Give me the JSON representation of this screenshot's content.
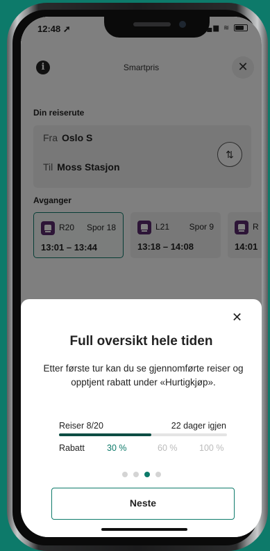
{
  "status_bar": {
    "time": "12:48",
    "location_glyph": "➚"
  },
  "header": {
    "title": "Smartpris",
    "info_glyph": "i",
    "close_glyph": "✕"
  },
  "route": {
    "section_label": "Din reiserute",
    "from_label": "Fra",
    "from_value": "Oslo S",
    "to_label": "Til",
    "to_value": "Moss Stasjon",
    "swap_glyph": "⇅"
  },
  "departures": {
    "section_label": "Avganger",
    "items": [
      {
        "line": "R20",
        "track": "Spor 18",
        "time": "13:01 – 13:44"
      },
      {
        "line": "L21",
        "track": "Spor 9",
        "time": "13:18 – 14:08"
      },
      {
        "line": "R",
        "track": "",
        "time": "14:01"
      }
    ]
  },
  "modal": {
    "close_glyph": "✕",
    "title": "Full oversikt hele tiden",
    "body": "Etter første tur kan du se gjennomførte reiser og opptjent rabatt under «Hurtigkjøp».",
    "trips_label": "Reiser 8/20",
    "days_left": "22 dager igjen",
    "progress_fraction": 0.55,
    "discount_label": "Rabatt",
    "discounts": [
      "30 %",
      "60 %",
      "100 %"
    ],
    "page_count": 4,
    "active_page": 3,
    "next_button": "Neste"
  },
  "colors": {
    "accent": "#0d7a6a",
    "background": "#0d7a6a",
    "train_icon": "#5a2a6e"
  }
}
